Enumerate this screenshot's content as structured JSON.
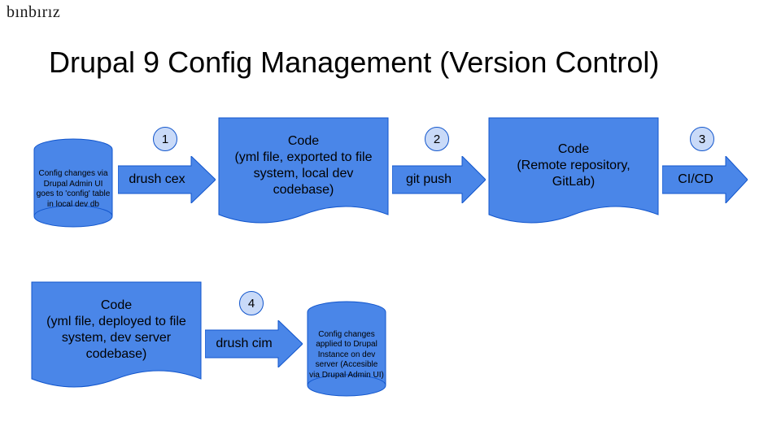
{
  "brand": "bınbırız",
  "title": "Drupal 9 Config Management (Version Control)",
  "cyl1": "Config changes via Drupal Admin UI goes to 'config' table in local dev db",
  "arrow1": "drush cex",
  "step1": "1",
  "doc1": "Code\n(yml file, exported to file system, local dev codebase)",
  "arrow2": "git push",
  "step2": "2",
  "doc2": "Code\n(Remote repository, GitLab)",
  "arrow3": "CI/CD",
  "step3": "3",
  "doc3": "Code\n(yml file, deployed to file system, dev server codebase)",
  "arrow4": "drush cim",
  "step4": "4",
  "cyl2": "Config changes applied to Drupal Instance on dev server (Accesible via Drupal Admin UI)"
}
